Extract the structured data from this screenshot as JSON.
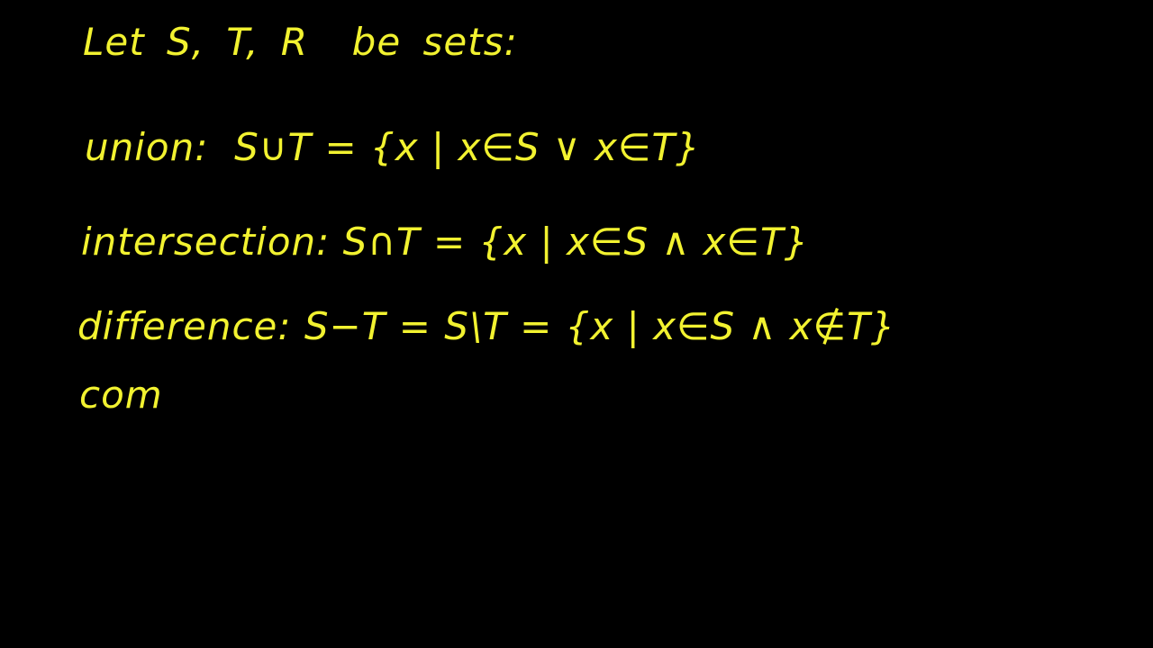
{
  "board": {
    "ink_color": "#f2f230",
    "background_color": "#000000",
    "lines": [
      "Let S, T, R  be sets:",
      "union:  S∪T = {x | x∈S ∨ x∈T}",
      "intersection: S∩T = {x | x∈S ∧ x∈T}",
      "difference: S−T = S\\T = {x | x∈S ∧ x∉T}",
      "com"
    ]
  }
}
